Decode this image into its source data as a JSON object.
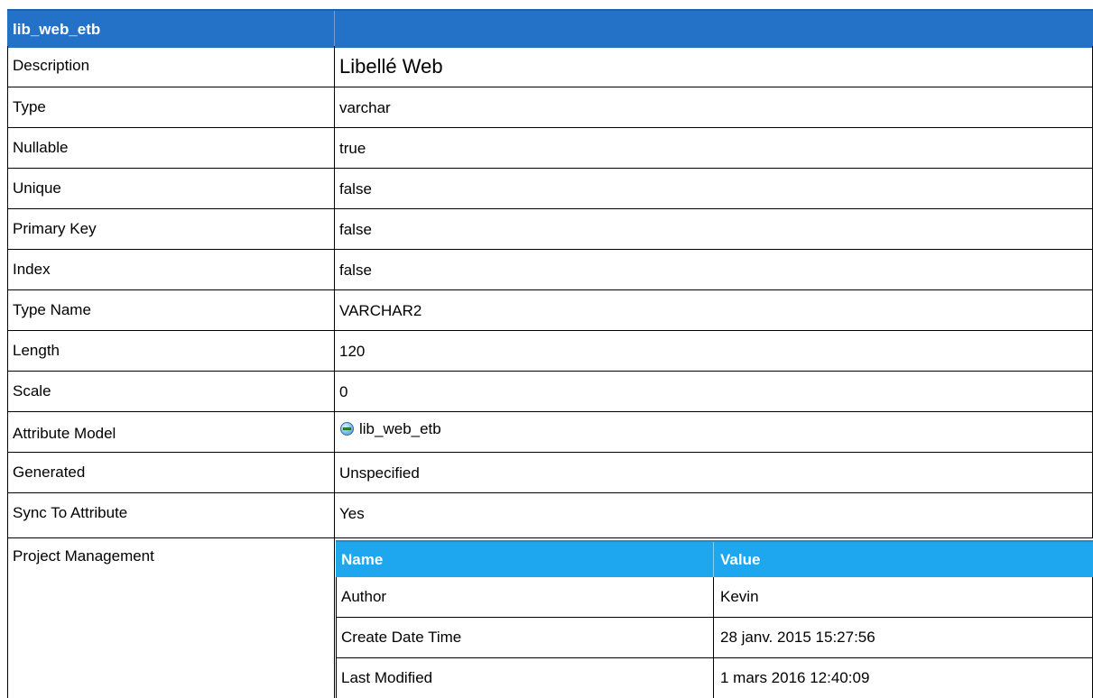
{
  "header": {
    "title": "lib_web_etb"
  },
  "rows": [
    {
      "label": "Description",
      "value": "Libellé Web"
    },
    {
      "label": "Type",
      "value": "varchar"
    },
    {
      "label": "Nullable",
      "value": "true"
    },
    {
      "label": "Unique",
      "value": "false"
    },
    {
      "label": "Primary Key",
      "value": "false"
    },
    {
      "label": "Index",
      "value": "false"
    },
    {
      "label": "Type Name",
      "value": "VARCHAR2"
    },
    {
      "label": "Length",
      "value": "120"
    },
    {
      "label": "Scale",
      "value": "0"
    },
    {
      "label": "Attribute Model",
      "value": "lib_web_etb",
      "icon": "attribute-icon"
    },
    {
      "label": "Generated",
      "value": "Unspecified"
    },
    {
      "label": "Sync To Attribute",
      "value": "Yes"
    }
  ],
  "project_management": {
    "label": "Project Management",
    "columns": [
      "Name",
      "Value"
    ],
    "rows": [
      {
        "name": "Author",
        "value": "Kevin"
      },
      {
        "name": "Create Date Time",
        "value": "28 janv. 2015 15:27:56"
      },
      {
        "name": "Last Modified",
        "value": "1 mars 2016 12:40:09"
      }
    ]
  },
  "colors": {
    "header_bg": "#2471c8",
    "subheader_bg": "#1ea7ef",
    "border": "#000000"
  }
}
